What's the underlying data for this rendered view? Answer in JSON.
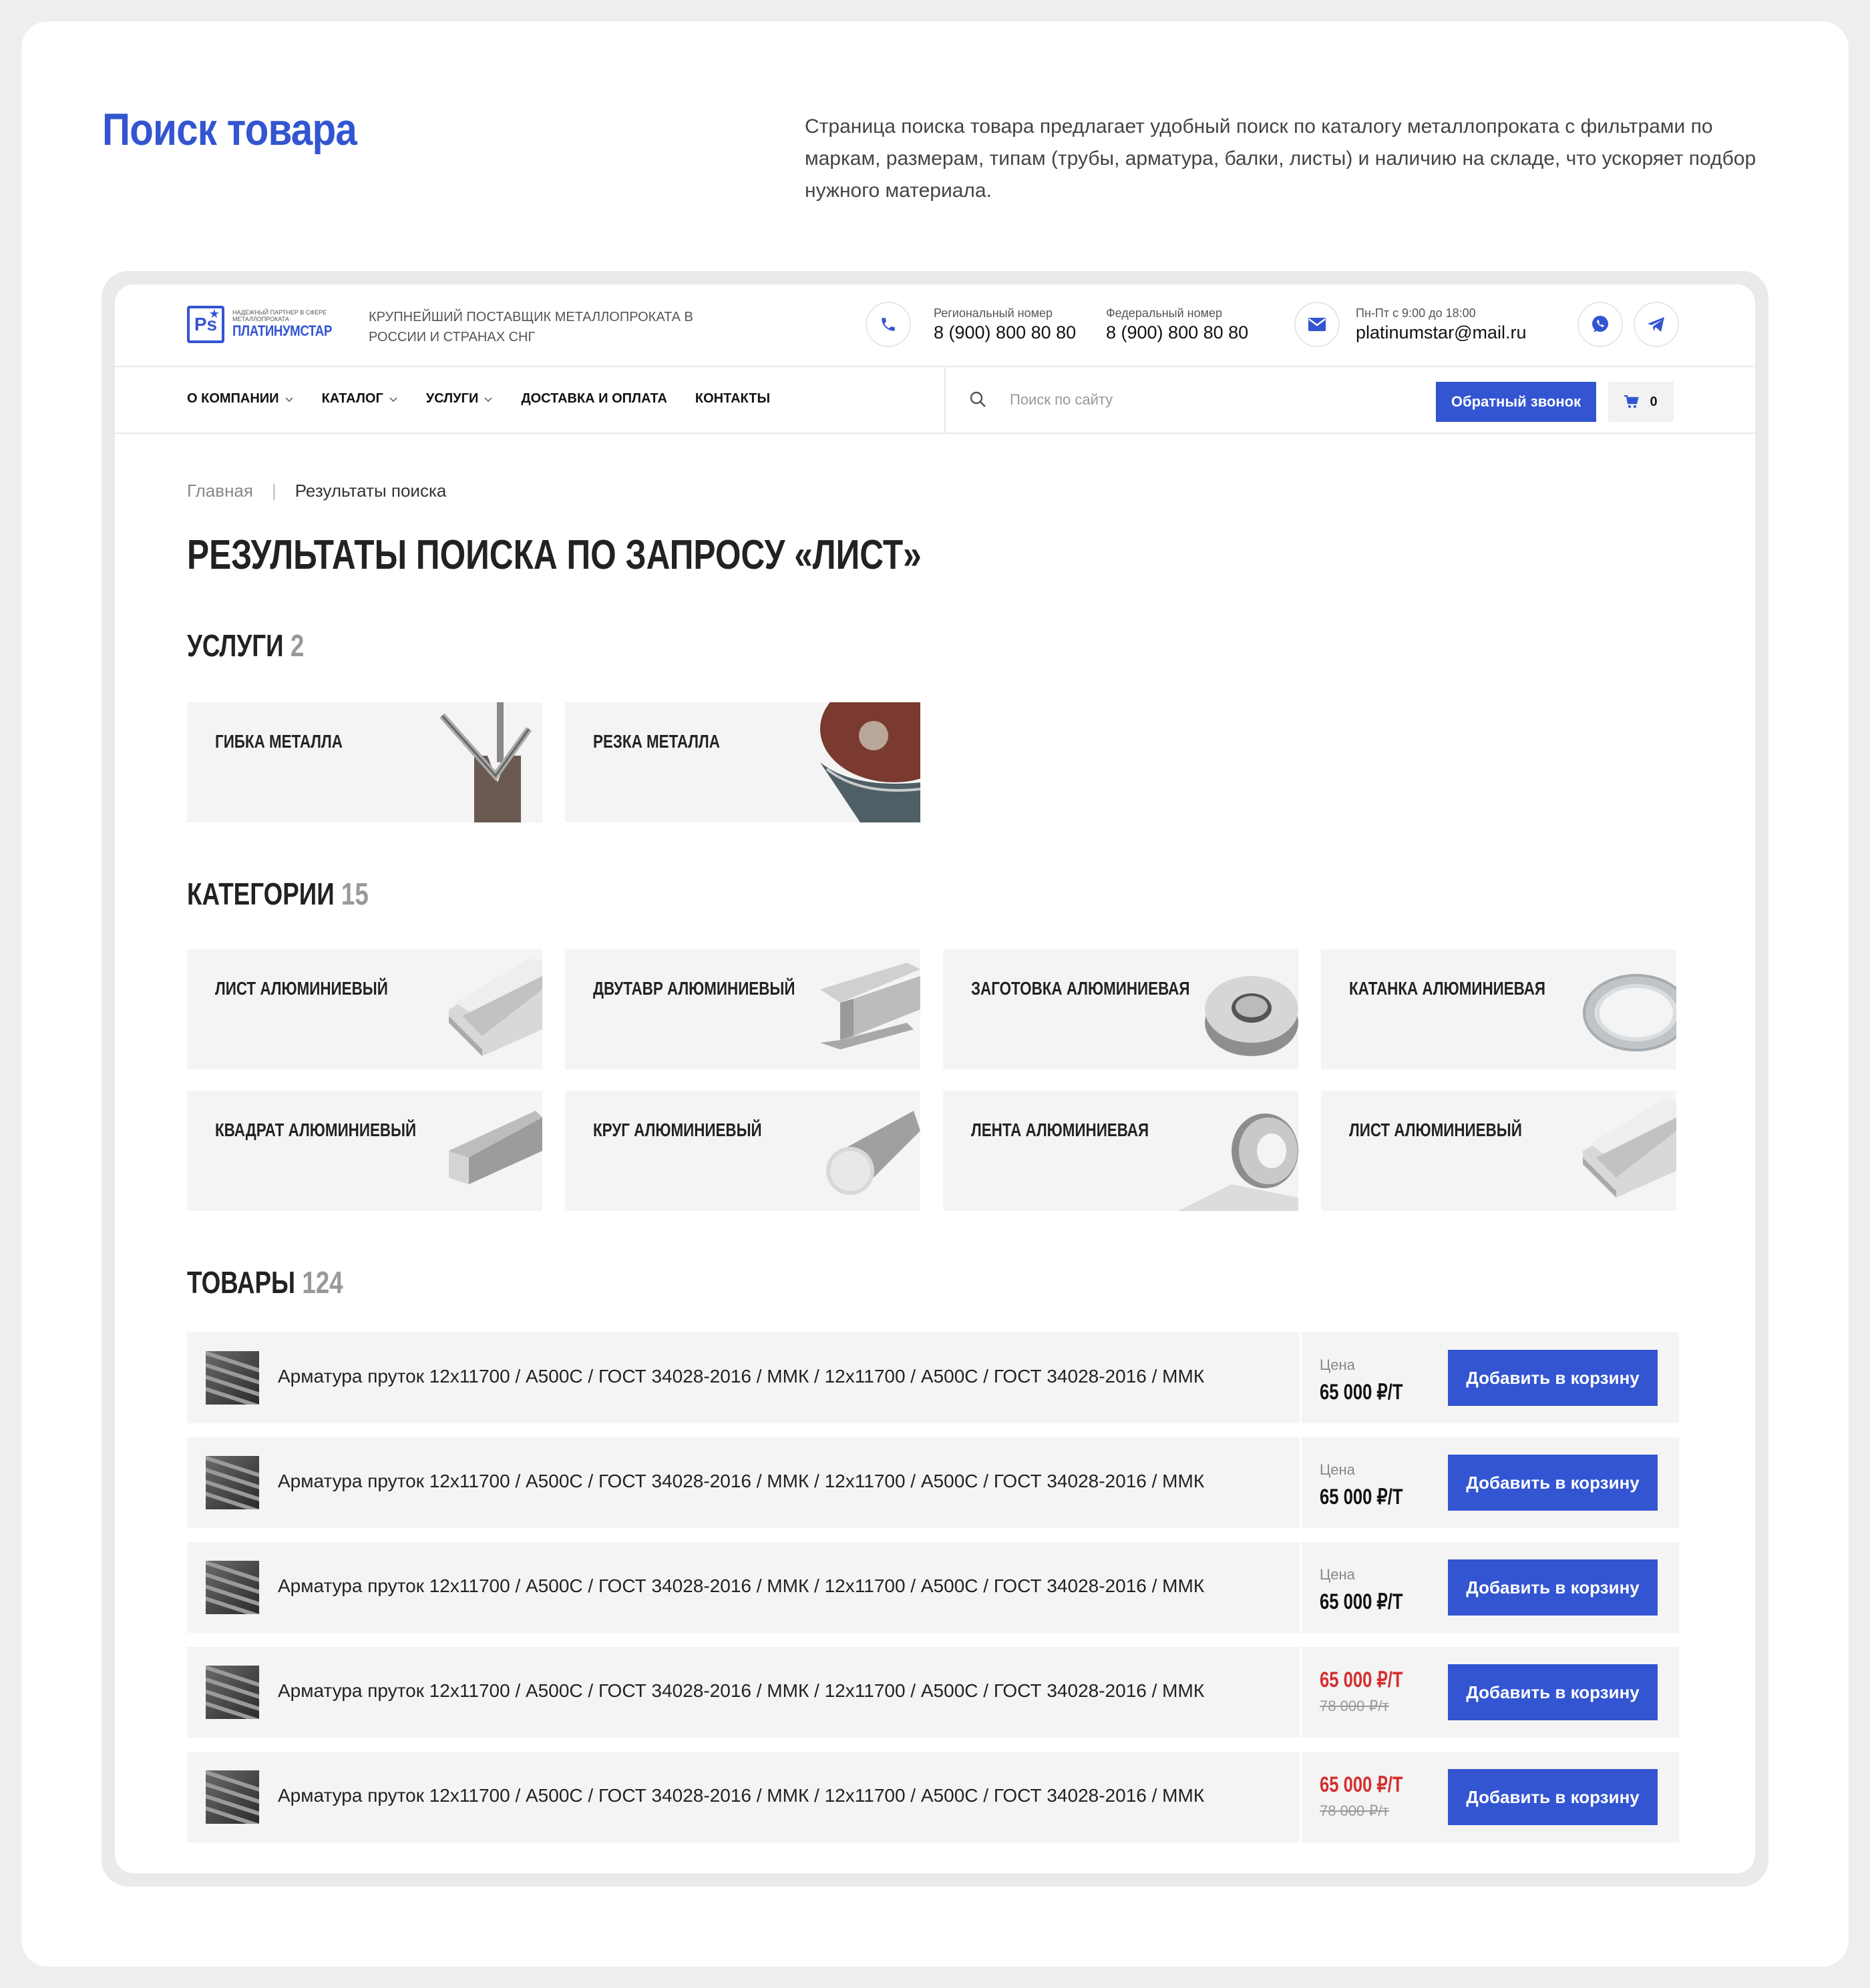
{
  "hero": {
    "title": "Поиск товара",
    "description": "Страница поиска товара предлагает удобный поиск по каталогу металлопроката с фильтрами по маркам, размерам, типам (трубы, арматура, балки, листы) и наличию на складе, что ускоряет подбор нужного материала."
  },
  "header": {
    "logo_tagline": "НАДЕЖНЫЙ ПАРТНЕР В СФЕРЕ МЕТАЛЛОПРОКАТА",
    "logo_name": "ПЛАТИНУМСТАР",
    "logo_badge": "Ps",
    "slogan": "Крупнейший поставщик металлопроката в России и странах СНГ",
    "regional_label": "Региональный номер",
    "regional_phone": "8 (900) 800 80 80",
    "federal_label": "Федеральный номер",
    "federal_phone": "8 (900) 800 80 80",
    "hours_label": "Пн-Пт с 9:00 до 18:00",
    "email": "platinumstar@mail.ru"
  },
  "nav": {
    "items": [
      {
        "label": "О компании",
        "dropdown": true
      },
      {
        "label": "Каталог",
        "dropdown": true
      },
      {
        "label": "Услуги",
        "dropdown": true
      },
      {
        "label": "Доставка и оплата",
        "dropdown": false
      },
      {
        "label": "Контакты",
        "dropdown": false
      }
    ],
    "search_placeholder": "Поиск по сайту",
    "callback_label": "Обратный звонок",
    "cart_count": "0"
  },
  "breadcrumb": {
    "home": "Главная",
    "current": "Результаты поиска"
  },
  "page_title": "Результаты поиска по запросу «лист»",
  "services": {
    "title": "Услуги",
    "count": "2",
    "items": [
      "Гибка металла",
      "Резка металла"
    ]
  },
  "categories": {
    "title": "Категории",
    "count": "15",
    "items": [
      "Лист алюминиевый",
      "Двутавр алюминиевый",
      "Заготовка алюминиевая",
      "Катанка алюминиевая",
      "Квадрат алюминиевый",
      "Круг алюминиевый",
      "Лента алюминиевая",
      "Лист алюминиевый"
    ]
  },
  "products": {
    "title": "Товары",
    "count": "124",
    "price_label": "Цена",
    "add_label": "Добавить в корзину",
    "items": [
      {
        "name": "Арматура пруток 12х11700 / А500С / ГОСТ 34028-2016 /  ММК / 12х11700 / А500С / ГОСТ 34028-2016 /  ММК",
        "price": "65 000 ₽/т",
        "old_price": ""
      },
      {
        "name": "Арматура пруток 12х11700 / А500С / ГОСТ 34028-2016 /  ММК / 12х11700 / А500С / ГОСТ 34028-2016 /  ММК",
        "price": "65 000 ₽/т",
        "old_price": ""
      },
      {
        "name": "Арматура пруток 12х11700 / А500С / ГОСТ 34028-2016 /  ММК / 12х11700 / А500С / ГОСТ 34028-2016 /  ММК",
        "price": "65 000 ₽/т",
        "old_price": ""
      },
      {
        "name": "Арматура пруток 12х11700 / А500С / ГОСТ 34028-2016 /  ММК / 12х11700 / А500С / ГОСТ 34028-2016 /  ММК",
        "price": "65 000 ₽/т",
        "old_price": "78 000 ₽/т"
      },
      {
        "name": "Арматура пруток 12х11700 / А500С / ГОСТ 34028-2016 /  ММК / 12х11700 / А500С / ГОСТ 34028-2016 /  ММК",
        "price": "65 000 ₽/т",
        "old_price": "78 000 ₽/т"
      }
    ]
  },
  "colors": {
    "accent": "#3355d1",
    "sale": "#d42e2e",
    "card_bg": "#f4f4f4"
  }
}
